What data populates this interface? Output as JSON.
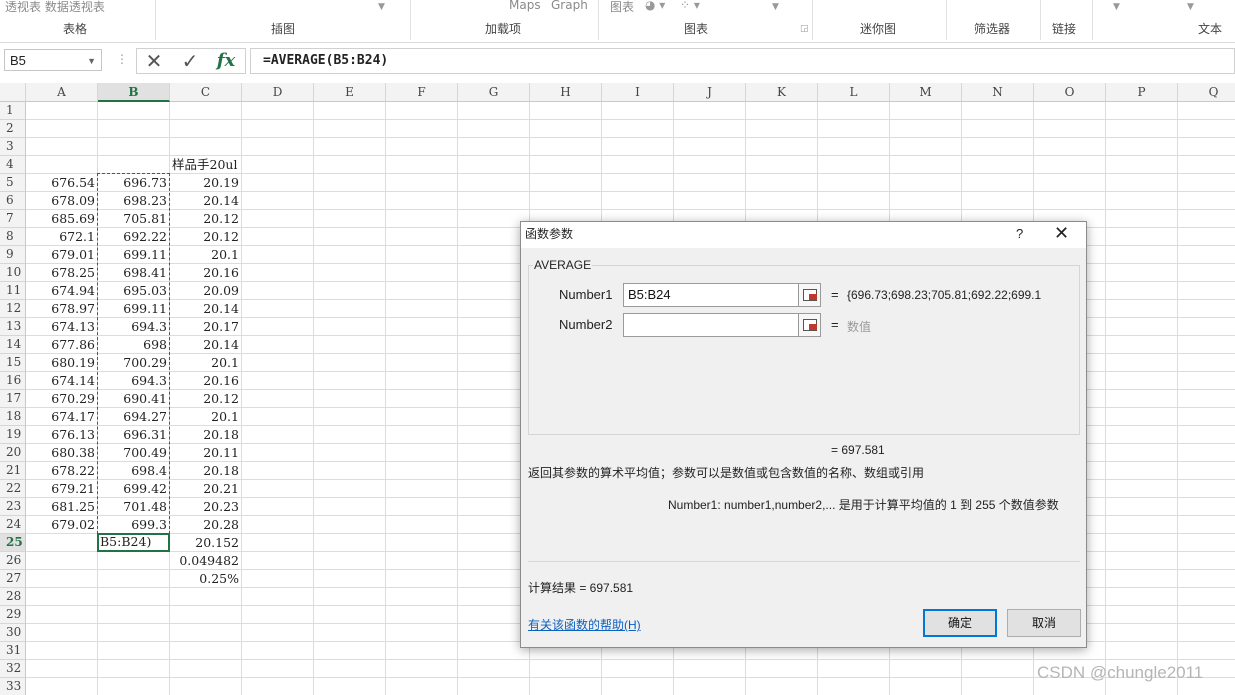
{
  "ribbon": {
    "top_items": [
      "透视表 数据透视表",
      "Maps",
      "Graph",
      "图表"
    ],
    "groups": [
      "表格",
      "插图",
      "加载项",
      "图表",
      "迷你图",
      "筛选器",
      "链接",
      "文本"
    ]
  },
  "formula_bar": {
    "name_box": "B5",
    "formula": "=AVERAGE(B5:B24)",
    "cancel_glyph": "✕",
    "enter_glyph": "✓",
    "fx_label": "fx"
  },
  "sheet": {
    "columns": [
      "A",
      "B",
      "C",
      "D",
      "E",
      "F",
      "G",
      "H",
      "I",
      "J",
      "K",
      "L",
      "M",
      "N",
      "O",
      "P",
      "Q"
    ],
    "selected_column": "B",
    "selected_row": 25,
    "rows": [
      "1",
      "2",
      "3",
      "4",
      "5",
      "6",
      "7",
      "8",
      "9",
      "10",
      "11",
      "12",
      "13",
      "14",
      "15",
      "16",
      "17",
      "18",
      "19",
      "20",
      "21",
      "22",
      "23",
      "24",
      "25",
      "26",
      "27",
      "28",
      "29",
      "30",
      "31",
      "32",
      "33"
    ],
    "c4_header": "样品手20ul",
    "data_a": [
      "676.54",
      "678.09",
      "685.69",
      "672.1",
      "679.01",
      "678.25",
      "674.94",
      "678.97",
      "674.13",
      "677.86",
      "680.19",
      "674.14",
      "670.29",
      "674.17",
      "676.13",
      "680.38",
      "678.22",
      "679.21",
      "681.25",
      "679.02"
    ],
    "data_b": [
      "696.73",
      "698.23",
      "705.81",
      "692.22",
      "699.11",
      "698.41",
      "695.03",
      "699.11",
      "694.3",
      "698",
      "700.29",
      "694.3",
      "690.41",
      "694.27",
      "696.31",
      "700.49",
      "698.4",
      "699.42",
      "701.48",
      "699.3"
    ],
    "data_c": [
      "20.19",
      "20.14",
      "20.12",
      "20.12",
      "20.1",
      "20.16",
      "20.09",
      "20.14",
      "20.17",
      "20.14",
      "20.1",
      "20.16",
      "20.12",
      "20.1",
      "20.18",
      "20.11",
      "20.18",
      "20.21",
      "20.23",
      "20.28"
    ],
    "b25_edit": "B5:B24)",
    "c25": "20.152",
    "c26": "0.049482",
    "c27": "0.25%"
  },
  "dialog": {
    "title": "函数参数",
    "help_glyph": "?",
    "close_glyph": "✕",
    "function_name": "AVERAGE",
    "args": [
      {
        "label": "Number1",
        "value": "B5:B24",
        "eq": "=",
        "result": "{696.73;698.23;705.81;692.22;699.1"
      },
      {
        "label": "Number2",
        "value": "",
        "eq": "=",
        "result": "数值"
      }
    ],
    "function_result": "=  697.581",
    "description": "返回其参数的算术平均值；参数可以是数值或包含数值的名称、数组或引用",
    "arg_help": "Number1:  number1,number2,... 是用于计算平均值的 1 到 255 个数值参数",
    "calc_result": "计算结果 =   697.581",
    "help_link": "有关该函数的帮助(H)",
    "ok_label": "确定",
    "cancel_label": "取消"
  },
  "watermark": "CSDN @chungle2011",
  "colors": {
    "excel_green": "#217346",
    "link_blue": "#0b61c0",
    "focus_blue": "#0078d7"
  }
}
